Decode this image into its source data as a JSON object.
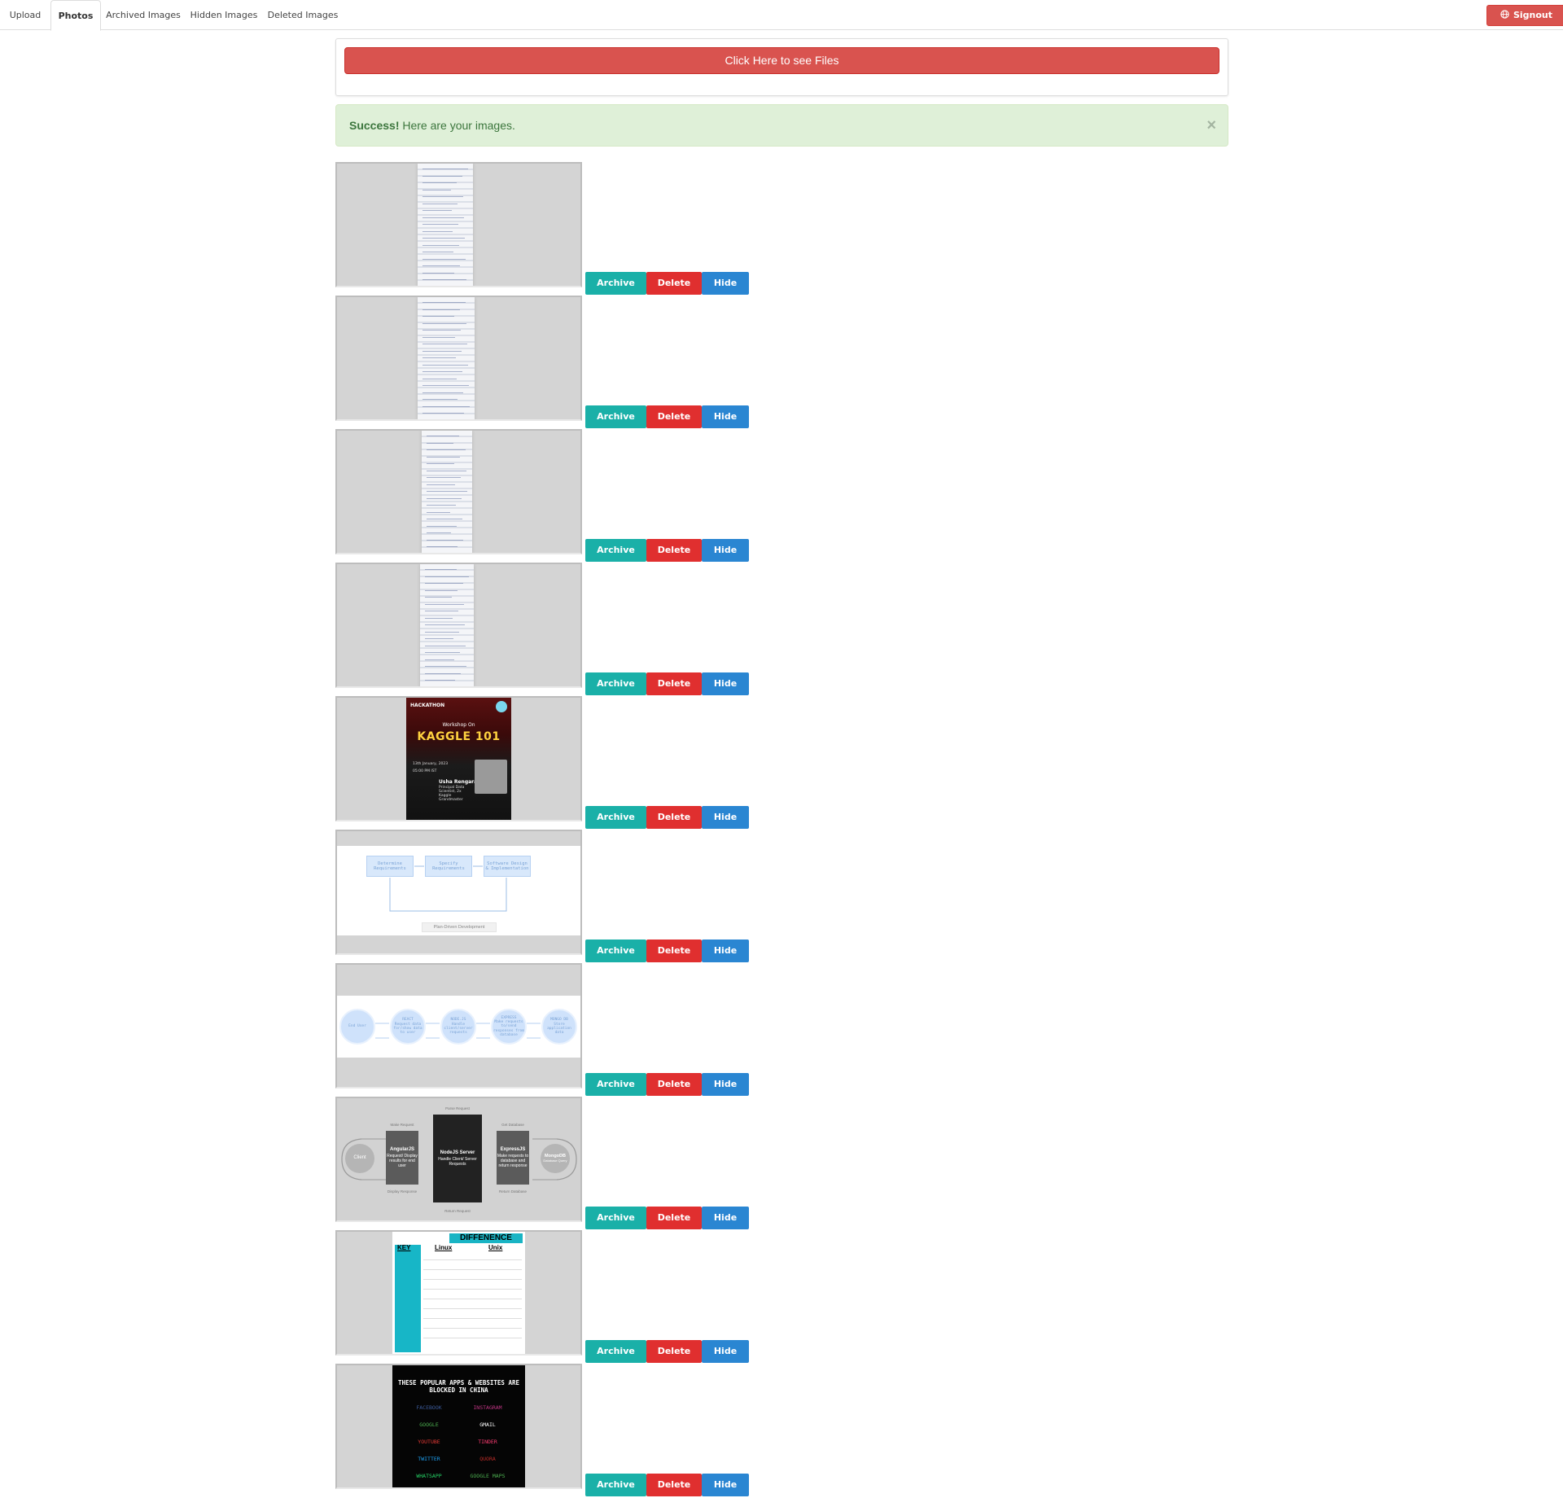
{
  "nav": {
    "tabs": [
      {
        "label": "Upload"
      },
      {
        "label": "Photos",
        "active": true
      },
      {
        "label": "Archived Images"
      },
      {
        "label": "Hidden Images"
      },
      {
        "label": "Deleted Images"
      }
    ],
    "signout_label": "Signout"
  },
  "files_button": "Click Here to see Files",
  "alert": {
    "strong": "Success!",
    "message": "Here are your images.",
    "close": "×"
  },
  "actions": {
    "archive": "Archive",
    "delete": "Delete",
    "hide": "Hide"
  },
  "images": {
    "kaggle": {
      "logo": "HACKATHON",
      "workshop": "Workshop On",
      "title": "KAGGLE 101",
      "date": "13th January, 2023",
      "time": "05:00 PM IST",
      "speaker": "Usha Rengaraju",
      "role": "Principal Data Scientist, 2x Kaggle Grandmaster"
    },
    "plan_driven": {
      "boxes": [
        "Determine Requirements",
        "Specify Requirements",
        "Software Design & Implementation"
      ],
      "caption": "Plan-Driven Development"
    },
    "mern": {
      "nodes": [
        {
          "title": "End User",
          "text": ""
        },
        {
          "title": "REACT",
          "text": "Request data for/show data to user"
        },
        {
          "title": "NODE.JS",
          "text": "Handle client/server requests"
        },
        {
          "title": "EXPRESS",
          "text": "Make requests to/send responses from database"
        },
        {
          "title": "MONGO DB",
          "text": "Store application data"
        }
      ]
    },
    "mean": {
      "client": "Client",
      "angular_title": "AngularJS",
      "angular_text": "Request/ Display results for end user",
      "node_title": "NodeJS Server",
      "node_text": "Handle Client/ Server Requests",
      "express_title": "ExpressJS",
      "express_text": "Make requests to database and return response",
      "mongo": "MongoDB",
      "mongo_sub": "Database Query",
      "labels": [
        "Make Request",
        "Parse Request",
        "Get Database",
        "Display Response",
        "Return Request",
        "Return Database"
      ]
    },
    "difference": {
      "header": "DIFFENENCE",
      "key": "KEY",
      "col1": "Linux",
      "col2": "Unix"
    },
    "blocked": {
      "title": "THESE POPULAR APPS & WEBSITES ARE BLOCKED IN CHINA",
      "left": [
        "FACEBOOK",
        "GOOGLE",
        "YOUTUBE",
        "TWITTER",
        "WHATSAPP"
      ],
      "right": [
        "INSTAGRAM",
        "GMAIL",
        "TINDER",
        "QUORA",
        "GOOGLE MAPS"
      ],
      "left_colors": [
        "#3b5998",
        "#4caf50",
        "#e53935",
        "#1da1f2",
        "#25d366"
      ],
      "right_colors": [
        "#c13584",
        "#ffffff",
        "#fe3c72",
        "#b92b27",
        "#4caf50"
      ]
    }
  },
  "colors": {
    "danger": "#d9534f",
    "success_bg": "#dff0d8",
    "archive": "#1ab0a8",
    "delete": "#e02f2f",
    "hide": "#2a86d2"
  }
}
